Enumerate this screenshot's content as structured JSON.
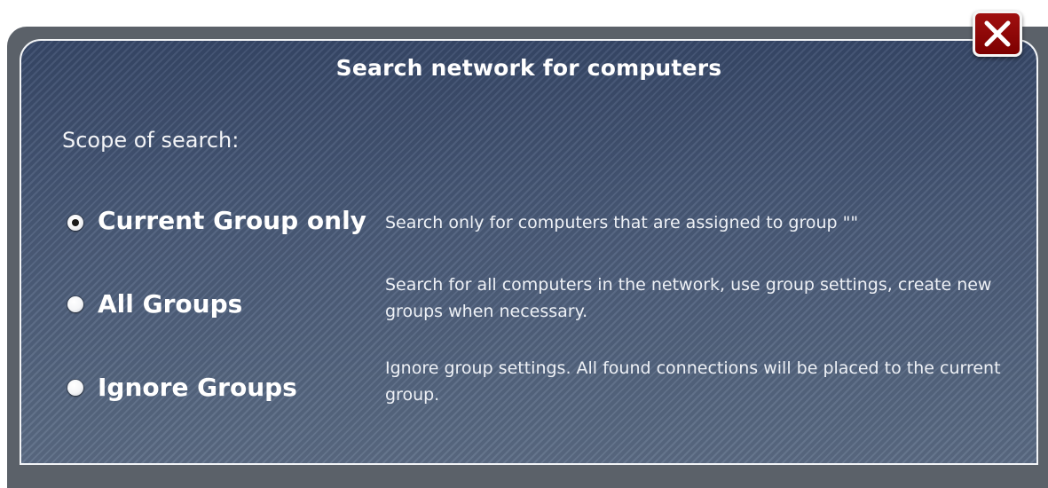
{
  "dialog": {
    "title": "Search network for computers",
    "scope_label": "Scope of search:",
    "close_icon": "close-icon"
  },
  "options": [
    {
      "label": "Current Group only",
      "description": "Search only for computers that are assigned to group \"\"",
      "selected": true
    },
    {
      "label": "All Groups",
      "description": "Search for all computers in the network, use group settings, create new groups when necessary.",
      "selected": false
    },
    {
      "label": "Ignore Groups",
      "description": "Ignore group settings. All found connections will be placed to the current group.",
      "selected": false
    }
  ],
  "colors": {
    "dialog_background": "#465777",
    "close_button": "#8b0000",
    "text": "#ffffff"
  }
}
